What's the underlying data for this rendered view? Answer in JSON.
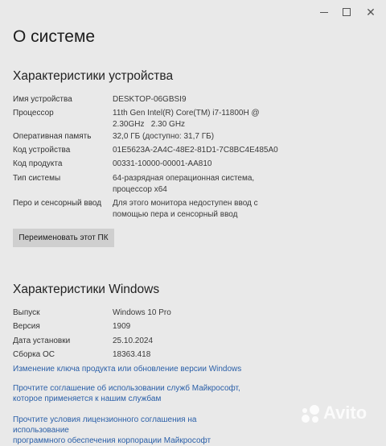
{
  "window": {
    "title": "О системе"
  },
  "device_section": {
    "title": "Характеристики устройства",
    "rows": [
      {
        "label": "Имя устройства",
        "value": "DESKTOP-06GBSI9"
      },
      {
        "label": "Процессор",
        "value": "11th Gen Intel(R) Core(TM) i7-11800H @",
        "value2": "2.30GHz   2.30 GHz"
      },
      {
        "label": "Оперативная память",
        "value": "32,0 ГБ (доступно: 31,7 ГБ)"
      },
      {
        "label": "Код устройства",
        "value": "01E5623A-2A4C-48E2-81D1-7C8BC4E485A0"
      },
      {
        "label": "Код продукта",
        "value": "00331-10000-00001-AA810"
      },
      {
        "label": "Тип системы",
        "value": "64-разрядная операционная система,",
        "value2": "процессор x64"
      },
      {
        "label": "Перо и сенсорный ввод",
        "value": "Для этого монитора недоступен ввод с",
        "value2": "помощью пера и сенсорный ввод"
      }
    ],
    "rename_button": "Переименовать этот ПК"
  },
  "windows_section": {
    "title": "Характеристики Windows",
    "rows": [
      {
        "label": "Выпуск",
        "value": "Windows 10 Pro"
      },
      {
        "label": "Версия",
        "value": "1909"
      },
      {
        "label": "Дата установки",
        "value": "25.10.2024"
      },
      {
        "label": "Сборка ОС",
        "value": "18363.418"
      }
    ],
    "links": [
      {
        "line1": "Изменение ключа продукта или обновление версии Windows"
      },
      {
        "line1": "Прочтите соглашение об использовании служб Майкрософт,",
        "line2": "которое применяется к нашим службам"
      },
      {
        "line1": "Прочтите условия лицензионного соглашения на использование",
        "line2": "программного обеспечения корпорации Майкрософт"
      }
    ]
  },
  "watermark": {
    "text": "Avito"
  },
  "colors": {
    "background": "#e9e9e9",
    "link": "#2a5fa8",
    "button": "#cfcfcf"
  }
}
